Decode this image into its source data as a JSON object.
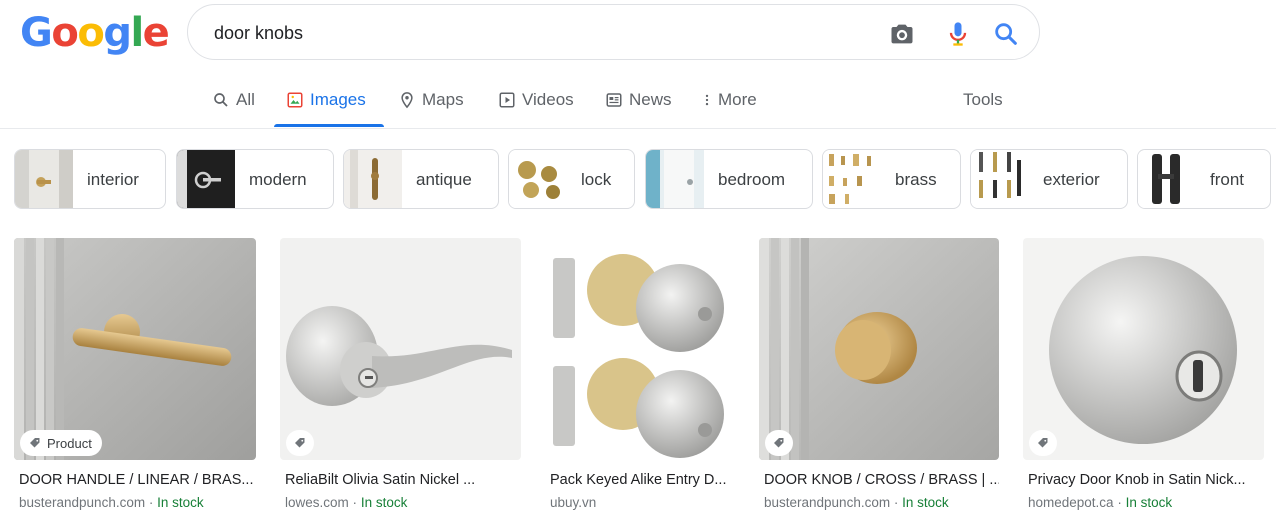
{
  "logo": {
    "text": "Google"
  },
  "search": {
    "query": "door knobs"
  },
  "tabs": [
    {
      "label": "All"
    },
    {
      "label": "Images"
    },
    {
      "label": "Maps"
    },
    {
      "label": "Videos"
    },
    {
      "label": "News"
    },
    {
      "label": "More"
    }
  ],
  "tools_label": "Tools",
  "colors": {
    "accent": "#1a73e8",
    "in_stock": "#188038"
  },
  "chips": [
    {
      "label": "interior"
    },
    {
      "label": "modern"
    },
    {
      "label": "antique"
    },
    {
      "label": "lock"
    },
    {
      "label": "bedroom"
    },
    {
      "label": "brass"
    },
    {
      "label": "exterior"
    },
    {
      "label": "front"
    }
  ],
  "results": [
    {
      "title": "DOOR HANDLE / LINEAR / BRAS...",
      "domain": "busterandpunch.com",
      "stock": "In stock",
      "badge": "Product"
    },
    {
      "title": "ReliaBilt Olivia Satin Nickel ...",
      "domain": "lowes.com",
      "stock": "In stock"
    },
    {
      "title": "Pack Keyed Alike Entry D...",
      "domain": "ubuy.vn"
    },
    {
      "title": "DOOR KNOB / CROSS / BRASS | ...",
      "domain": "busterandpunch.com",
      "stock": "In stock"
    },
    {
      "title": "Privacy Door Knob in Satin Nick...",
      "domain": "homedepot.ca",
      "stock": "In stock"
    }
  ],
  "sep": "·"
}
